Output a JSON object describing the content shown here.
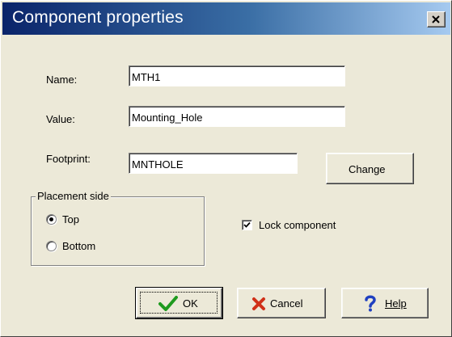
{
  "dialog": {
    "title": "Component properties",
    "close_icon": "close-icon"
  },
  "fields": {
    "name": {
      "label": "Name:",
      "value": "MTH1"
    },
    "value": {
      "label": "Value:",
      "value": "Mounting_Hole"
    },
    "footprint": {
      "label": "Footprint:",
      "value": "MNTHOLE"
    }
  },
  "change_button": {
    "label": "Change"
  },
  "placement": {
    "legend": "Placement side",
    "options": [
      {
        "label": "Top",
        "selected": true
      },
      {
        "label": "Bottom",
        "selected": false
      }
    ]
  },
  "lock": {
    "label": "Lock component",
    "checked": true
  },
  "buttons": {
    "ok": {
      "label": "OK",
      "icon": "checkmark-icon",
      "color": "#1e9a1e"
    },
    "cancel": {
      "label": "Cancel",
      "icon": "x-icon",
      "color": "#d03018"
    },
    "help": {
      "label": "Help",
      "icon": "question-icon",
      "color": "#2040c0"
    }
  }
}
